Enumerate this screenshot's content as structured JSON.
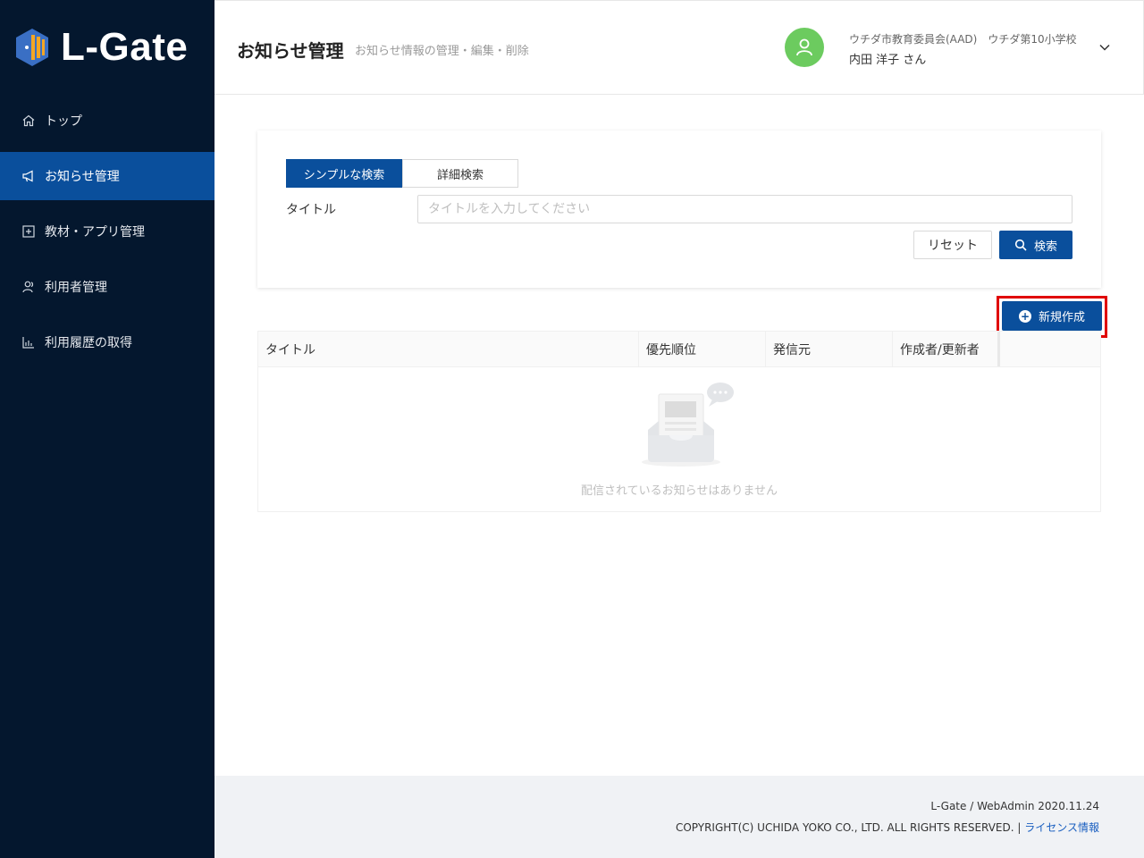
{
  "brand": {
    "name": "L-Gate"
  },
  "sidebar": {
    "items": [
      {
        "label": "トップ",
        "icon": "home-icon",
        "active": false
      },
      {
        "label": "お知らせ管理",
        "icon": "megaphone-icon",
        "active": true
      },
      {
        "label": "教材・アプリ管理",
        "icon": "plus-square-icon",
        "active": false
      },
      {
        "label": "利用者管理",
        "icon": "users-icon",
        "active": false
      },
      {
        "label": "利用履歴の取得",
        "icon": "bar-chart-icon",
        "active": false
      }
    ]
  },
  "header": {
    "title": "お知らせ管理",
    "subtitle": "お知らせ情報の管理・編集・削除",
    "org": "ウチダ市教育委員会(AAD)　ウチダ第10小学校",
    "user": "内田 洋子 さん"
  },
  "search": {
    "tabs": [
      "シンプルな検索",
      "詳細検索"
    ],
    "active_tab": "シンプルな検索",
    "field_label": "タイトル",
    "placeholder": "タイトルを入力してください",
    "value": "",
    "reset_label": "リセット",
    "search_label": "検索"
  },
  "actions": {
    "new_label": "新規作成"
  },
  "table": {
    "columns": [
      "タイトル",
      "優先順位",
      "発信元",
      "作成者/更新者",
      ""
    ],
    "rows": [],
    "empty_text": "配信されているお知らせはありません"
  },
  "footer": {
    "version": "L-Gate / WebAdmin 2020.11.24",
    "copyright": "COPYRIGHT(C) UCHIDA YOKO CO., LTD. ALL RIGHTS RESERVED. | ",
    "license_link": "ライセンス情報"
  },
  "colors": {
    "sidebar_bg": "#04172e",
    "primary": "#0a4f9c",
    "avatar": "#6ccb5f",
    "highlight": "#e00000"
  }
}
